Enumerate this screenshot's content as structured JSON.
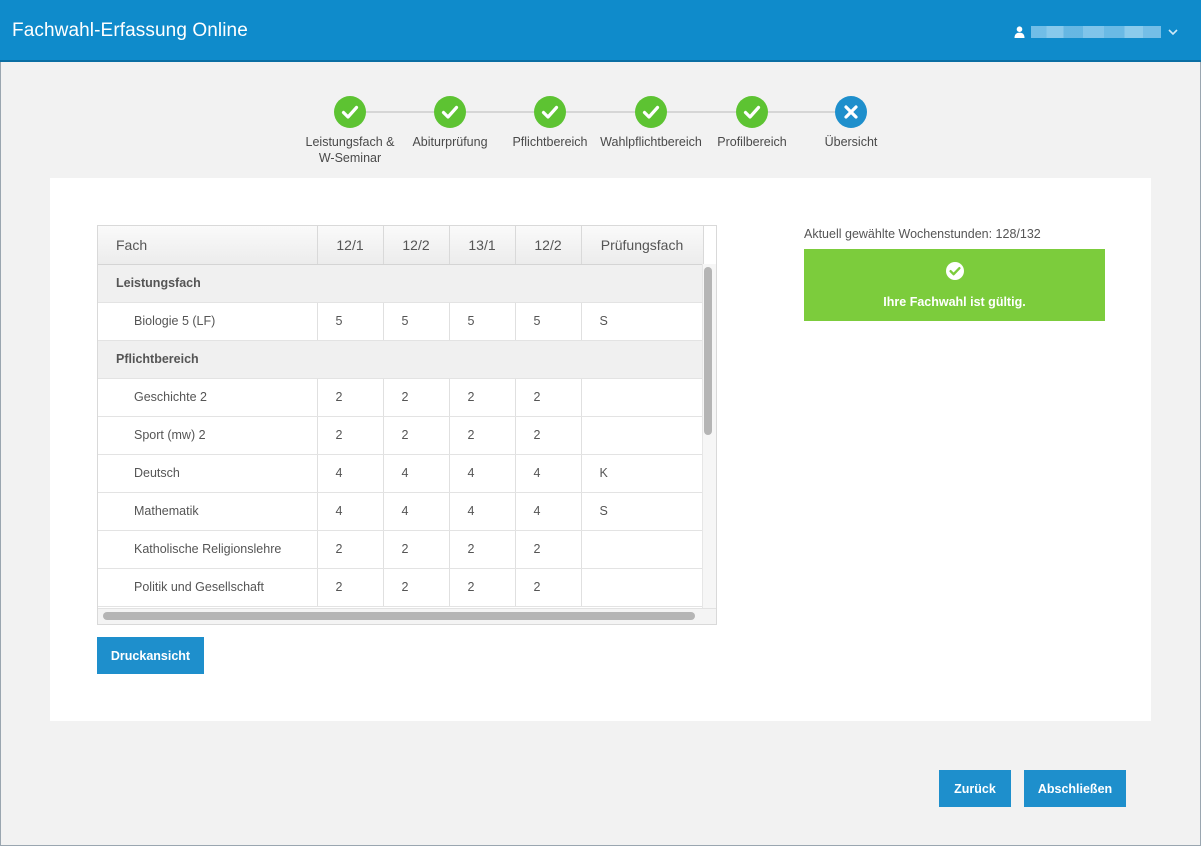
{
  "app": {
    "title": "Fachwahl-Erfassung Online"
  },
  "user": {
    "icon": "user-icon",
    "dropdown_icon": "chevron-down-icon"
  },
  "steps": [
    {
      "label": "Leistungsfach &\nW-Seminar",
      "status": "done"
    },
    {
      "label": "Abiturprüfung",
      "status": "done"
    },
    {
      "label": "Pflichtbereich",
      "status": "done"
    },
    {
      "label": "Wahlpflichtbereich",
      "status": "done"
    },
    {
      "label": "Profilbereich",
      "status": "done"
    },
    {
      "label": "Übersicht",
      "status": "current"
    }
  ],
  "table": {
    "headers": [
      "Fach",
      "12/1",
      "12/2",
      "13/1",
      "12/2",
      "Prüfungsfach"
    ],
    "rows": [
      {
        "group": "Leistungsfach"
      },
      {
        "name": "Biologie 5 (LF)",
        "cells": [
          "5",
          "5",
          "5",
          "5",
          "S"
        ]
      },
      {
        "group": "Pflichtbereich"
      },
      {
        "name": "Geschichte 2",
        "cells": [
          "2",
          "2",
          "2",
          "2",
          ""
        ]
      },
      {
        "name": "Sport (mw) 2",
        "cells": [
          "2",
          "2",
          "2",
          "2",
          ""
        ]
      },
      {
        "name": "Deutsch",
        "cells": [
          "4",
          "4",
          "4",
          "4",
          "K"
        ]
      },
      {
        "name": "Mathematik",
        "cells": [
          "4",
          "4",
          "4",
          "4",
          "S"
        ]
      },
      {
        "name": "Katholische Religionslehre",
        "cells": [
          "2",
          "2",
          "2",
          "2",
          ""
        ]
      },
      {
        "name": "Politik und Gesellschaft",
        "cells": [
          "2",
          "2",
          "2",
          "2",
          ""
        ]
      }
    ]
  },
  "summary": {
    "hours_text": "Aktuell gewählte Wochenstunden: 128/132",
    "valid_text": "Ihre Fachwahl ist gültig.",
    "valid_color": "#7ccc3c"
  },
  "buttons": {
    "print": "Druckansicht",
    "back": "Zurück",
    "finish": "Abschließen"
  },
  "colors": {
    "primary": "#1e8fcc",
    "navbar": "#0f8bcb",
    "success": "#5dc332"
  }
}
